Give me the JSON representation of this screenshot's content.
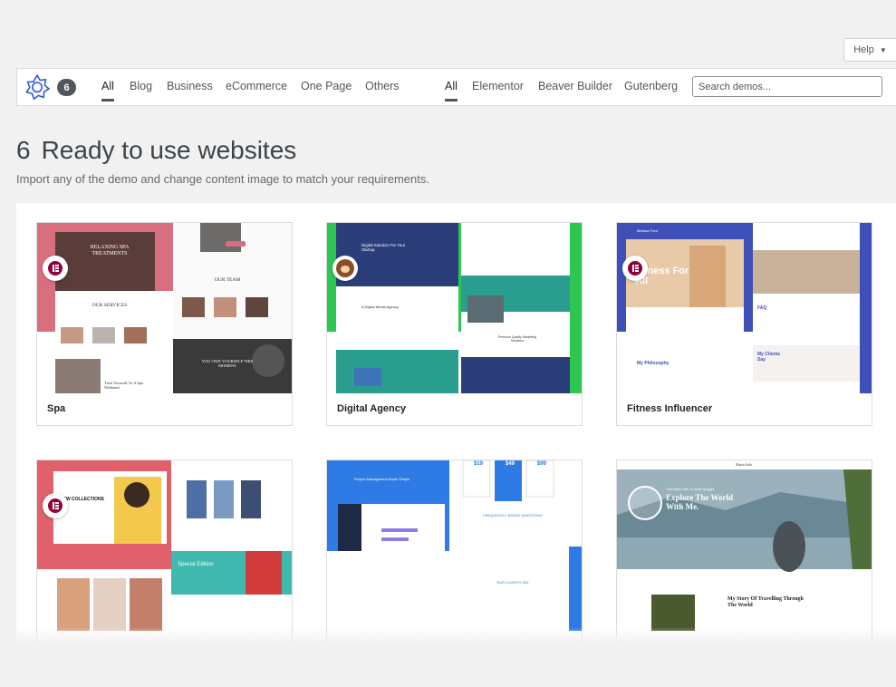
{
  "help": {
    "label": "Help",
    "caret": "▼"
  },
  "filters": {
    "count": "6",
    "categories": [
      "All",
      "Blog",
      "Business",
      "eCommerce",
      "One Page",
      "Others"
    ],
    "builders": [
      "All",
      "Elementor",
      "Beaver Builder",
      "Gutenberg"
    ],
    "search_placeholder": "Search demos..."
  },
  "heading": {
    "count": "6",
    "title": "Ready to use websites",
    "description": "Import any of the demo and change content image to match your requirements."
  },
  "demos": [
    {
      "name": "Spa",
      "builder": "elementor-icon",
      "thumb": {
        "hero_title": "RELAXING SPA TREATMENTS",
        "section_services": "OUR SERVICES",
        "section_team": "OUR TEAM",
        "banner": "YOU OWE YOURSELF THIS MOMENT",
        "promo": "Treat Yourself To A Spa Weekend"
      }
    },
    {
      "name": "Digital Agency",
      "builder": "beaver-icon",
      "thumb": {
        "hero_title": "Digital Solution For Your Startup",
        "sub": "A Digital Media Agency",
        "cta": "Premium Quality Marketing Solutions"
      }
    },
    {
      "name": "Fitness Influencer",
      "builder": "elementor-icon",
      "thumb": {
        "brand": "Melissa Ford",
        "hero_title": "Fitness For All",
        "philosophy": "My Philosophy",
        "faq": "FAQ",
        "clients": "My Clients Say"
      }
    },
    {
      "name": "",
      "builder": "elementor-icon",
      "thumb": {
        "hero_title": "NEW COLLECTIONS",
        "promo": "Special Edition"
      }
    },
    {
      "name": "",
      "builder": "",
      "thumb": {
        "hero_title": "Project Management Made Simple",
        "prices": [
          "$19",
          "$49",
          "$99"
        ],
        "faq": "FREQUENTLY ASKED QUESTIONS",
        "clients": "OUR CLIENTS SAY"
      }
    },
    {
      "name": "",
      "builder": "",
      "thumb": {
        "brand": "Maria Sola",
        "kicker": "I am Maria Sola - A Travel Blogger",
        "hero_title": "Explore The World With Me.",
        "story": "My Story Of Travelling Through The World"
      }
    }
  ],
  "colors": {
    "spa": "#d86f7e",
    "agency_green": "#2dc651",
    "agency_teal": "#2a9e8e",
    "fitness_blue": "#3f4fb8",
    "shop_red": "#e0606c",
    "pm_blue": "#2e7be6",
    "travel": "#5b7f93"
  }
}
